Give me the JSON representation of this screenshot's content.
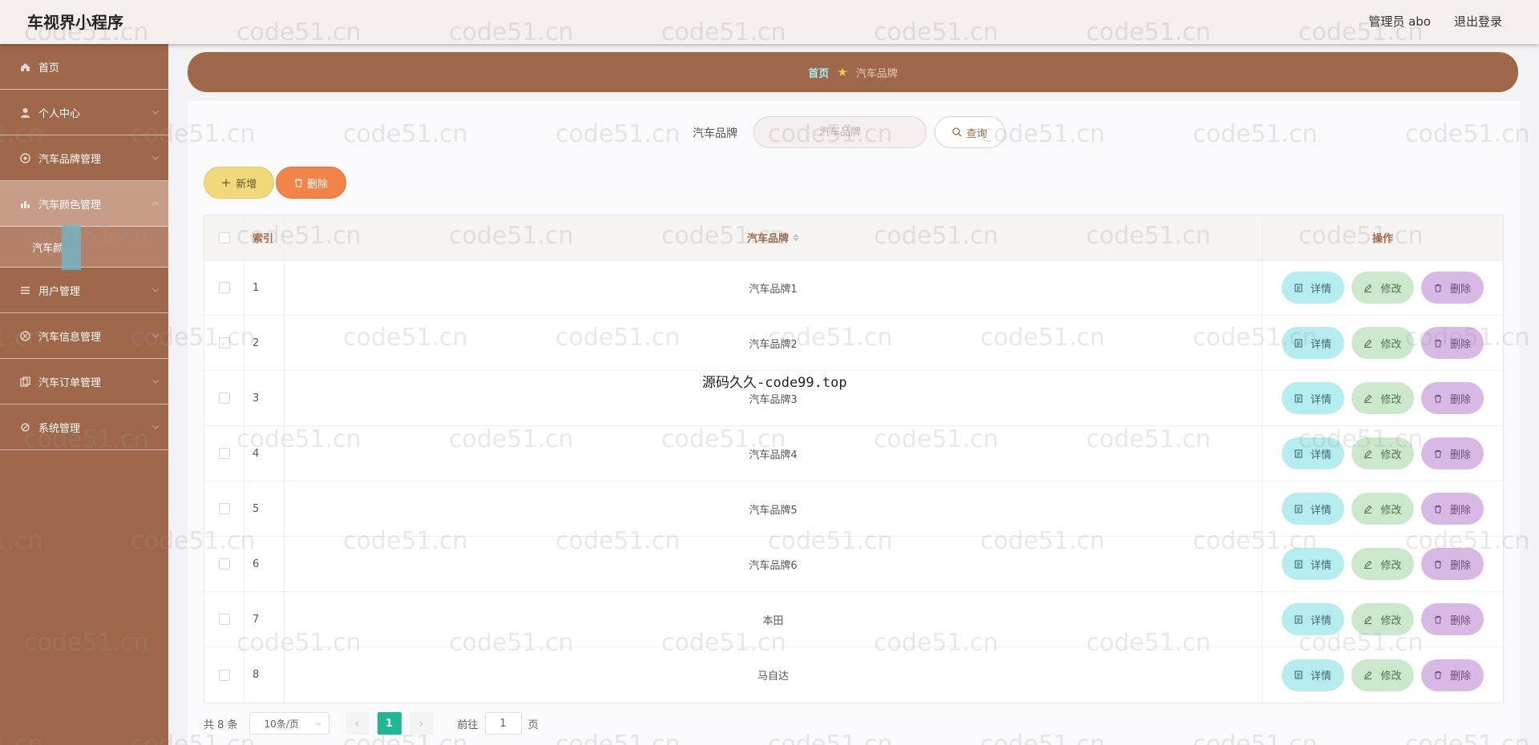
{
  "header": {
    "app_title": "车视界小程序",
    "admin_label": "管理员 abo",
    "logout": "退出登录"
  },
  "sidebar": {
    "items": [
      {
        "label": "首页",
        "icon": "home-icon"
      },
      {
        "label": "个人中心",
        "icon": "user-icon"
      },
      {
        "label": "汽车品牌管理",
        "icon": "brand-icon"
      },
      {
        "label": "汽车颜色管理",
        "icon": "chart-icon"
      },
      {
        "label": "用户管理",
        "icon": "menu-icon"
      },
      {
        "label": "汽车信息管理",
        "icon": "info-icon"
      },
      {
        "label": "汽车订单管理",
        "icon": "order-icon"
      },
      {
        "label": "系统管理",
        "icon": "settings-icon"
      }
    ],
    "sub_item": "汽车颜"
  },
  "breadcrumb": {
    "home": "首页",
    "current": "汽车品牌"
  },
  "search": {
    "label": "汽车品牌",
    "placeholder": "汽车品牌",
    "button": "查询"
  },
  "toolbar": {
    "add_label": "新增",
    "delete_label": "删除"
  },
  "table": {
    "headers": {
      "index": "索引",
      "brand": "汽车品牌",
      "ops": "操作"
    },
    "rows": [
      {
        "index": "1",
        "brand": "汽车品牌1"
      },
      {
        "index": "2",
        "brand": "汽车品牌2"
      },
      {
        "index": "3",
        "brand": "汽车品牌3"
      },
      {
        "index": "4",
        "brand": "汽车品牌4"
      },
      {
        "index": "5",
        "brand": "汽车品牌5"
      },
      {
        "index": "6",
        "brand": "汽车品牌6"
      },
      {
        "index": "7",
        "brand": "本田"
      },
      {
        "index": "8",
        "brand": "马自达"
      }
    ],
    "actions": {
      "detail": "详情",
      "edit": "修改",
      "delete": "删除"
    }
  },
  "pagination": {
    "total": "共 8 条",
    "page_size": "10条/页",
    "current_page": "1",
    "goto_prefix": "前往",
    "goto_value": "1",
    "goto_suffix": "页"
  },
  "watermarks": {
    "repeat": "code51.cn",
    "center": "源码久久-code99.top"
  },
  "colors": {
    "sidebar": "#a0684a",
    "accent_teal": "#1fb892",
    "add_button": "#efd97a",
    "delete_button": "#f28449"
  }
}
